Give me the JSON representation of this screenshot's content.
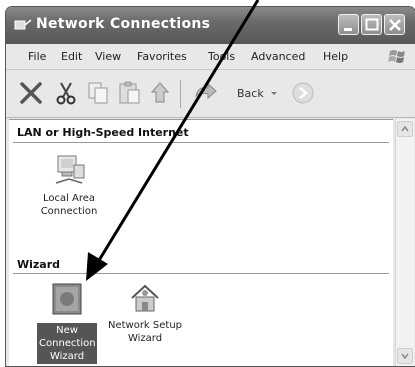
{
  "window": {
    "title": "Network Connections"
  },
  "menu": [
    "File",
    "Edit",
    "View",
    "Favorites",
    "Tools",
    "Advanced",
    "Help"
  ],
  "toolbar": {
    "back_label": "Back"
  },
  "groups": [
    {
      "header": "LAN or High-Speed Internet",
      "items": [
        {
          "line1": "Local Area",
          "line2": "Connection",
          "icon": "network-computer-icon"
        }
      ]
    },
    {
      "header": "Wizard",
      "items": [
        {
          "line1": "New",
          "line2": "Connection",
          "line3": "Wizard",
          "icon": "new-connection-wizard-icon",
          "selected": true
        },
        {
          "line1": "Network Setup",
          "line2": "Wizard",
          "icon": "home-network-icon"
        }
      ]
    }
  ]
}
